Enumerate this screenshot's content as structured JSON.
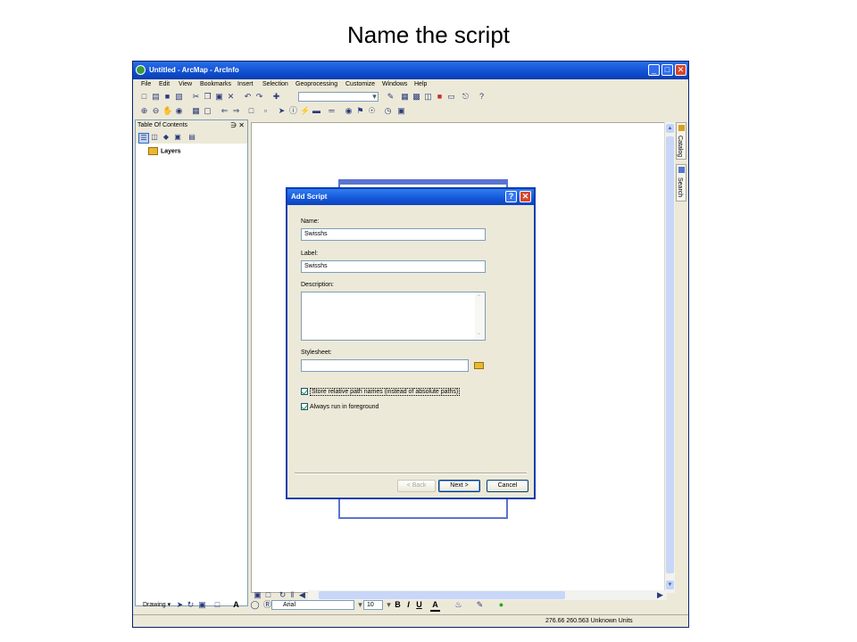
{
  "slide": {
    "title": "Name the script"
  },
  "window": {
    "title": "Untitled - ArcMap - ArcInfo",
    "min_icon": "minimize-icon",
    "max_icon": "maximize-icon",
    "close_icon": "close-icon"
  },
  "menu": [
    "File",
    "Edit",
    "View",
    "Bookmarks",
    "Insert",
    "Selection",
    "Geoprocessing",
    "Customize",
    "Windows",
    "Help"
  ],
  "toc": {
    "title": "Table Of Contents",
    "pin": "p",
    "close": "×",
    "layers_label": "Layers"
  },
  "side_tabs": {
    "catalog": "Catalog",
    "search": "Search"
  },
  "drawing": {
    "drawing_label": "Drawing ▾",
    "font_name": "Arial",
    "font_size": "10",
    "bold": "B",
    "italic": "I",
    "underline": "U",
    "font_color": "A"
  },
  "status": {
    "coordinates": "276.66  260.563 Unknown Units"
  },
  "dialog": {
    "title": "Add Script",
    "help": "?",
    "close": "✕",
    "name_label": "Name:",
    "name_value": "Swisshs",
    "label_label": "Label:",
    "label_value": "Swisshs",
    "description_label": "Description:",
    "description_value": "",
    "stylesheet_label": "Stylesheet:",
    "stylesheet_value": "",
    "store_relative_label": "Store relative path names (instead of absolute paths)",
    "store_relative_checked": true,
    "foreground_label": "Always run in foreground",
    "foreground_checked": true,
    "back_button": "< Back",
    "next_button": "Next >",
    "cancel_button": "Cancel"
  }
}
